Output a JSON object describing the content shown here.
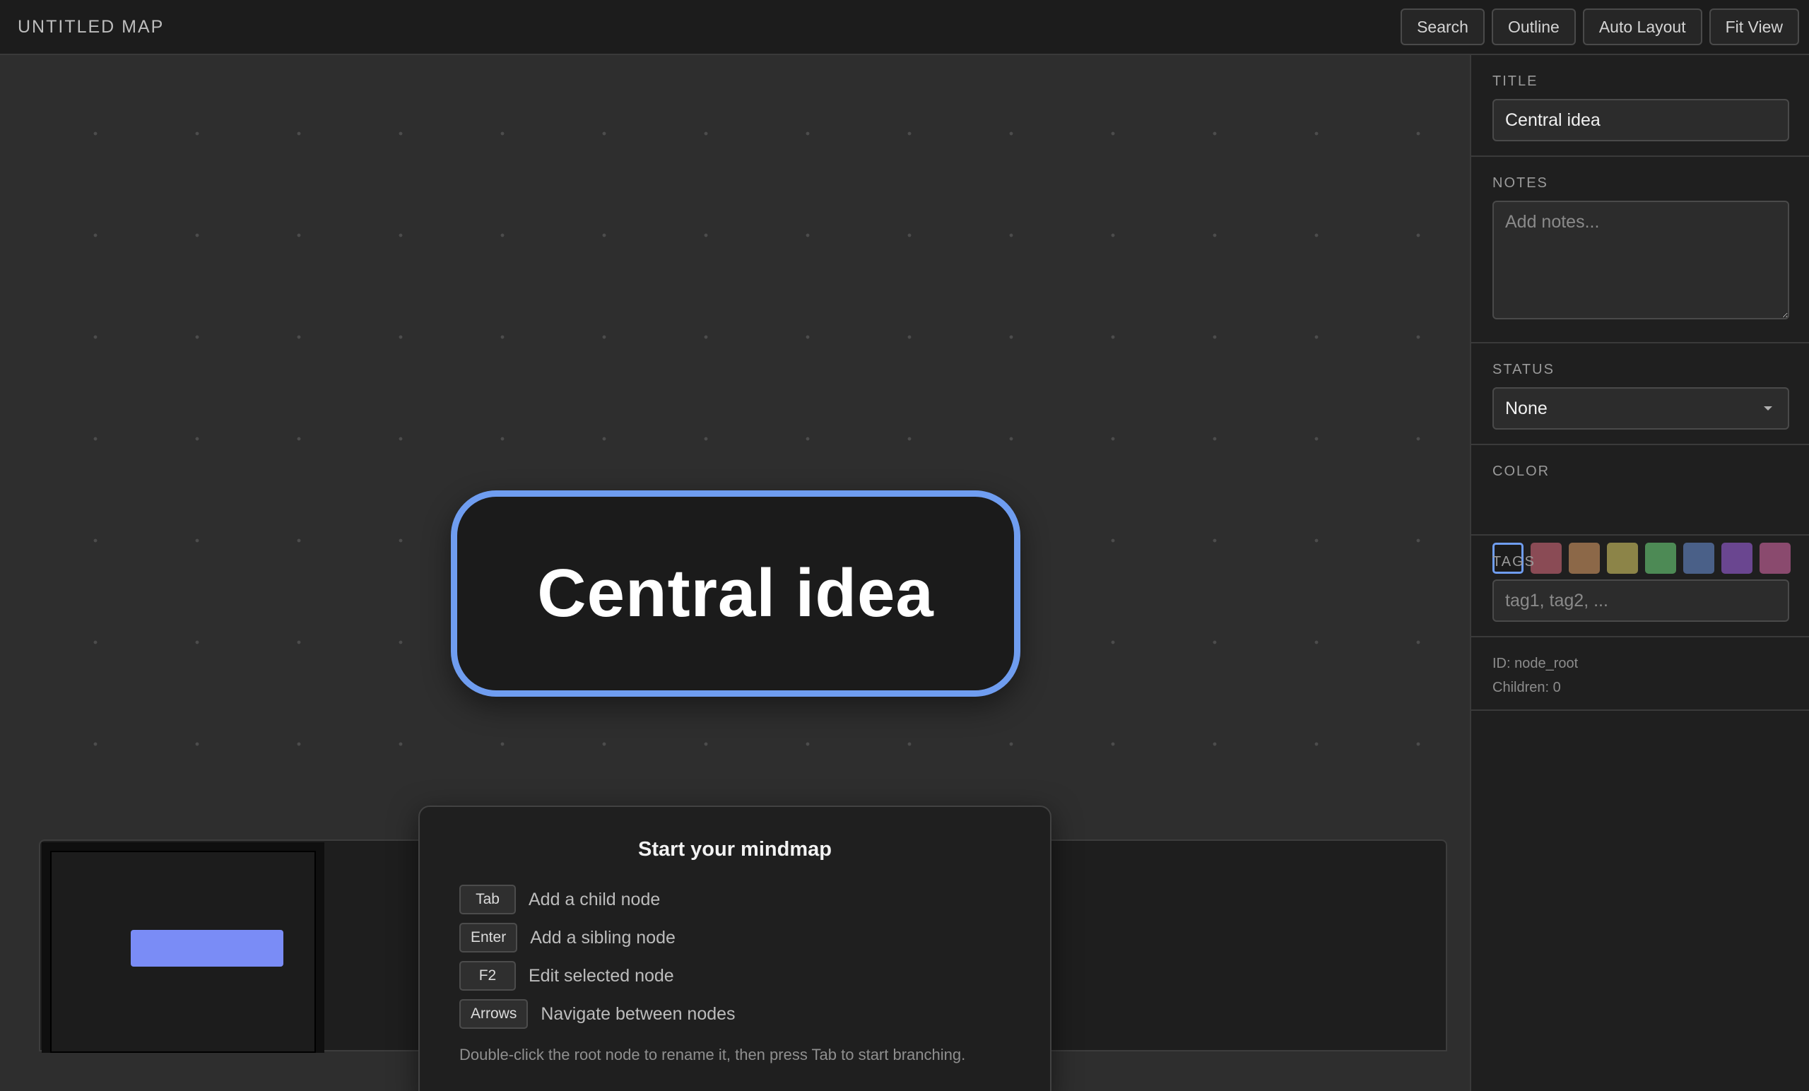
{
  "app": {
    "title": "UNTITLED MAP"
  },
  "toolbar": {
    "buttons": [
      {
        "label": "Search"
      },
      {
        "label": "Outline"
      },
      {
        "label": "Auto Layout"
      },
      {
        "label": "Fit View"
      }
    ]
  },
  "canvas": {
    "root_node": {
      "label": "Central idea",
      "border_color": "#6f9df0"
    }
  },
  "hints": {
    "title": "Start your mindmap",
    "items": [
      {
        "key": "Tab",
        "text": "Add a child node"
      },
      {
        "key": "Enter",
        "text": "Add a sibling node"
      },
      {
        "key": "F2",
        "text": "Edit selected node"
      },
      {
        "key": "Arrows",
        "text": "Navigate between nodes"
      }
    ],
    "footer": "Double-click the root node to rename it, then press Tab to start branching."
  },
  "minimap": {
    "node_color": "#7a8cf6"
  },
  "panel": {
    "title_label": "TITLE",
    "title_value": "Central idea",
    "notes_label": "NOTES",
    "notes_placeholder": "Add notes...",
    "status_label": "STATUS",
    "status_value": "None",
    "color_label": "COLOR",
    "colors": [
      "#1b1b1b",
      "#8a4b55",
      "#8c6848",
      "#8c8448",
      "#4d8a55",
      "#4a6088",
      "#6a4690",
      "#8a4a6e"
    ],
    "selected_color_index": 0,
    "tags_label": "TAGS",
    "tags_placeholder": "tag1, tag2, ...",
    "id_text": "ID: node_root",
    "children_text": "Children: 0"
  }
}
